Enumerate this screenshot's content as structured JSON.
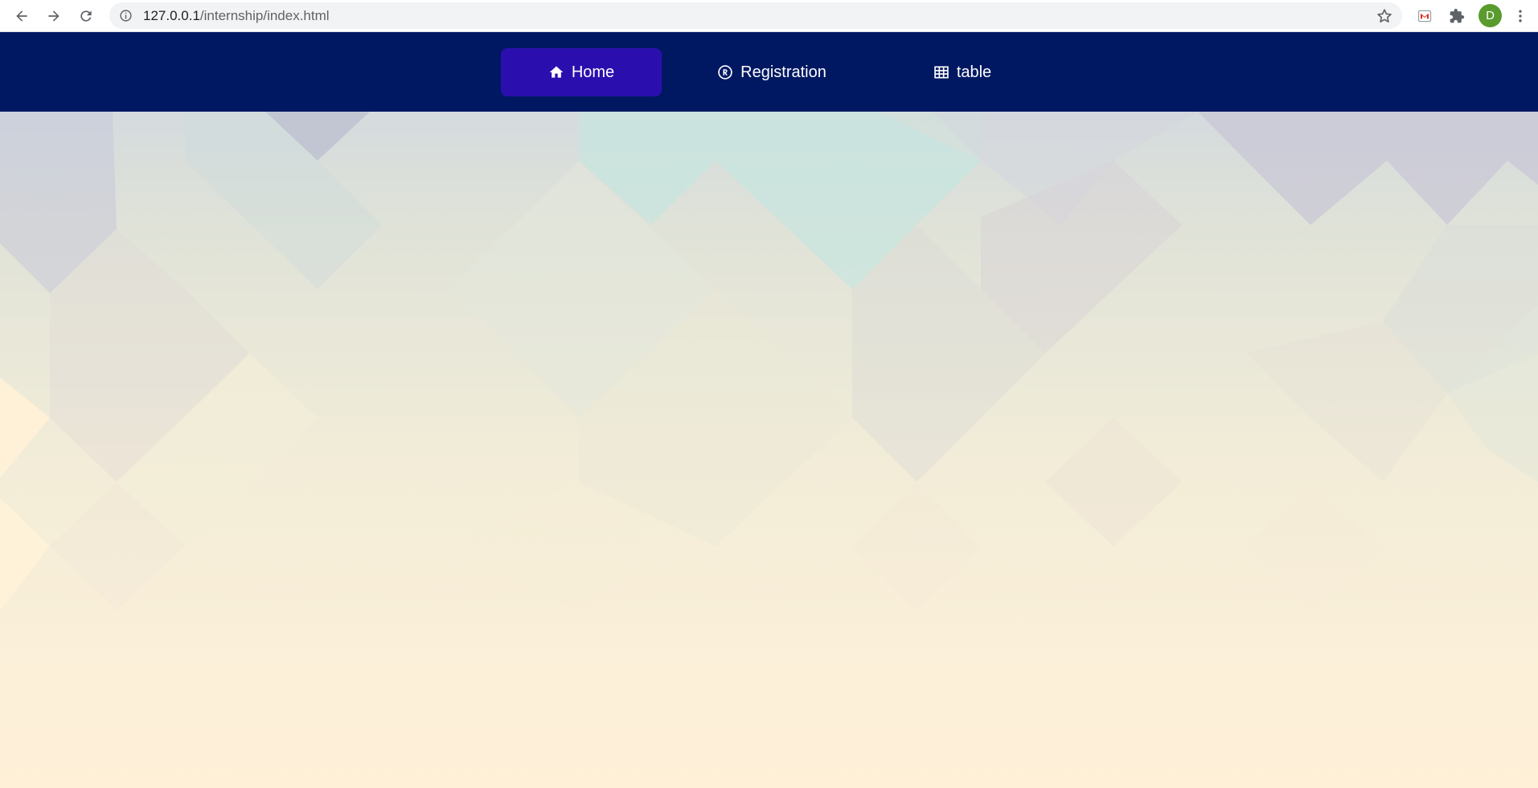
{
  "browser": {
    "url_host": "127.0.0.1",
    "url_path": "/internship/index.html",
    "profile_initial": "D",
    "icons": [
      "back-arrow-icon",
      "forward-arrow-icon",
      "reload-icon",
      "site-info-icon",
      "bookmark-star-icon",
      "extension-mail-icon",
      "puzzle-extensions-icon",
      "more-vert-icon"
    ]
  },
  "navbar": {
    "background": "#001862",
    "active_background": "#2b0fae",
    "items": [
      {
        "label": "Home",
        "icon": "home-icon",
        "active": true
      },
      {
        "label": "Registration",
        "icon": "registered-icon",
        "active": false
      },
      {
        "label": "table",
        "icon": "table-icon",
        "active": false
      }
    ]
  }
}
